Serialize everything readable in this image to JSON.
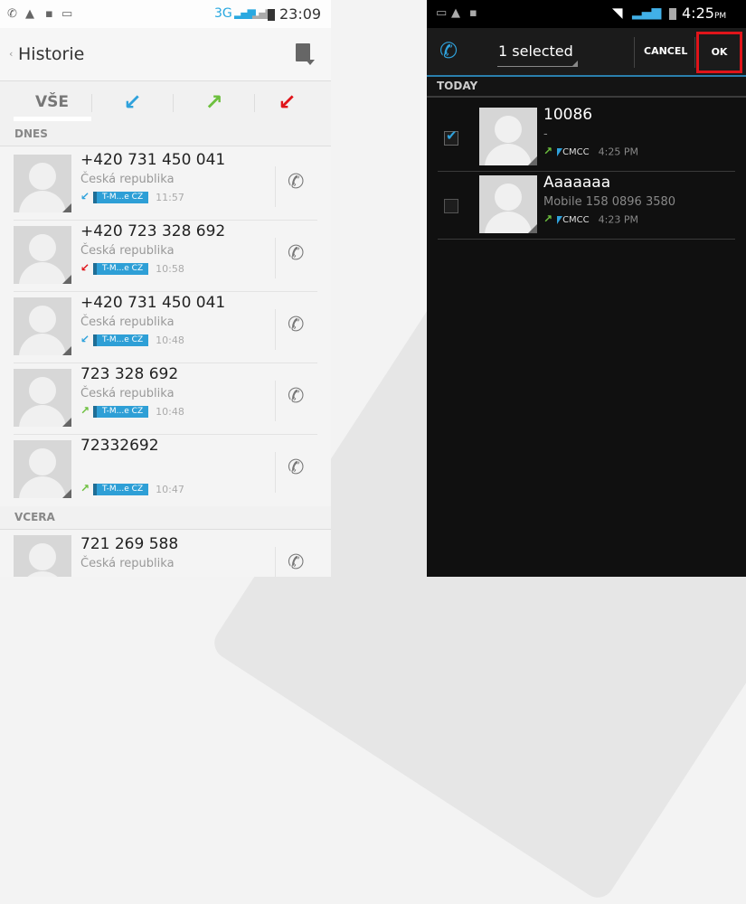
{
  "left": {
    "status": {
      "network": "3G",
      "time": "23:09"
    },
    "title": "Historie",
    "back_glyph": "‹",
    "tabs": [
      {
        "label": "VŠE",
        "icon": "all-calls"
      },
      {
        "label": "",
        "icon": "incoming-arrow-icon",
        "glyph": "↙",
        "color": "#2fa2dc"
      },
      {
        "label": "",
        "icon": "outgoing-arrow-icon",
        "glyph": "↗",
        "color": "#6dc03e"
      },
      {
        "label": "",
        "icon": "missed-arrow-icon",
        "glyph": "↙",
        "color": "#e0141a"
      }
    ],
    "section_today": "DNES",
    "section_yesterday": "VCERA",
    "calls": [
      {
        "number": "+420 731 450 041",
        "location": "Česká republika",
        "type": "incoming",
        "sim": "T-M...e CZ",
        "time": "11:57"
      },
      {
        "number": "+420 723 328 692",
        "location": "Česká republika",
        "type": "missed",
        "sim": "T-M...e CZ",
        "time": "10:58"
      },
      {
        "number": "+420 731 450 041",
        "location": "Česká republika",
        "type": "incoming",
        "sim": "T-M...e CZ",
        "time": "10:48"
      },
      {
        "number": "723 328 692",
        "location": "Česká republika",
        "type": "outgoing",
        "sim": "T-M...e CZ",
        "time": "10:48"
      },
      {
        "number": "72332692",
        "location": "",
        "type": "outgoing",
        "sim": "T-M...e CZ",
        "time": "10:47"
      }
    ],
    "yesterday_calls": [
      {
        "number": "721 269 588",
        "location": "Česká republika"
      }
    ]
  },
  "right": {
    "status": {
      "time": "4:25",
      "ampm": "PM"
    },
    "selected_label": "1 selected",
    "cancel_label": "CANCEL",
    "ok_label": "OK",
    "section": "TODAY",
    "calls": [
      {
        "name": "10086",
        "sub": "-",
        "checked": true,
        "sim": "CMCC",
        "time": "4:25 PM"
      },
      {
        "name": "Aaaaaaa",
        "sub": "Mobile 158 0896 3580",
        "checked": false,
        "sim": "CMCC",
        "time": "4:23 PM"
      }
    ]
  },
  "colors": {
    "incoming": "#2fa2dc",
    "outgoing": "#6dc03e",
    "missed": "#e0141a",
    "highlight": "#e0141a"
  }
}
